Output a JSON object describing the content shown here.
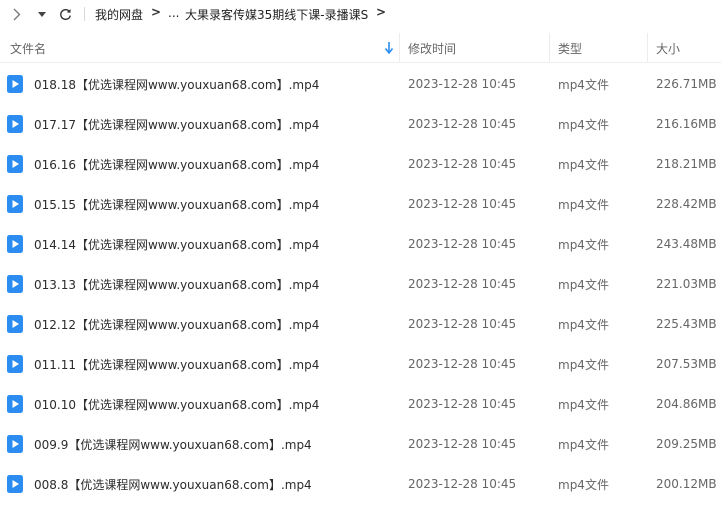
{
  "toolbar": {
    "forward_icon": "chevron-right-icon",
    "dropdown_icon": "caret-down-icon",
    "refresh_icon": "refresh-icon",
    "breadcrumb": [
      "我的网盘",
      "...",
      "大果录客传媒35期线下课-录播课S"
    ]
  },
  "columns": {
    "name": "文件名",
    "modified": "修改时间",
    "type": "类型",
    "size": "大小"
  },
  "colors": {
    "file_icon": "#2d8cf0",
    "text": "#2b2b2b",
    "muted": "#666666"
  },
  "files": [
    {
      "name": "018.18【优选课程网www.youxuan68.com】.mp4",
      "modified": "2023-12-28 10:45",
      "type": "mp4文件",
      "size": "226.71MB"
    },
    {
      "name": "017.17【优选课程网www.youxuan68.com】.mp4",
      "modified": "2023-12-28 10:45",
      "type": "mp4文件",
      "size": "216.16MB"
    },
    {
      "name": "016.16【优选课程网www.youxuan68.com】.mp4",
      "modified": "2023-12-28 10:45",
      "type": "mp4文件",
      "size": "218.21MB"
    },
    {
      "name": "015.15【优选课程网www.youxuan68.com】.mp4",
      "modified": "2023-12-28 10:45",
      "type": "mp4文件",
      "size": "228.42MB"
    },
    {
      "name": "014.14【优选课程网www.youxuan68.com】.mp4",
      "modified": "2023-12-28 10:45",
      "type": "mp4文件",
      "size": "243.48MB"
    },
    {
      "name": "013.13【优选课程网www.youxuan68.com】.mp4",
      "modified": "2023-12-28 10:45",
      "type": "mp4文件",
      "size": "221.03MB"
    },
    {
      "name": "012.12【优选课程网www.youxuan68.com】.mp4",
      "modified": "2023-12-28 10:45",
      "type": "mp4文件",
      "size": "225.43MB"
    },
    {
      "name": "011.11【优选课程网www.youxuan68.com】.mp4",
      "modified": "2023-12-28 10:45",
      "type": "mp4文件",
      "size": "207.53MB"
    },
    {
      "name": "010.10【优选课程网www.youxuan68.com】.mp4",
      "modified": "2023-12-28 10:45",
      "type": "mp4文件",
      "size": "204.86MB"
    },
    {
      "name": "009.9【优选课程网www.youxuan68.com】.mp4",
      "modified": "2023-12-28 10:45",
      "type": "mp4文件",
      "size": "209.25MB"
    },
    {
      "name": "008.8【优选课程网www.youxuan68.com】.mp4",
      "modified": "2023-12-28 10:45",
      "type": "mp4文件",
      "size": "200.12MB"
    }
  ]
}
